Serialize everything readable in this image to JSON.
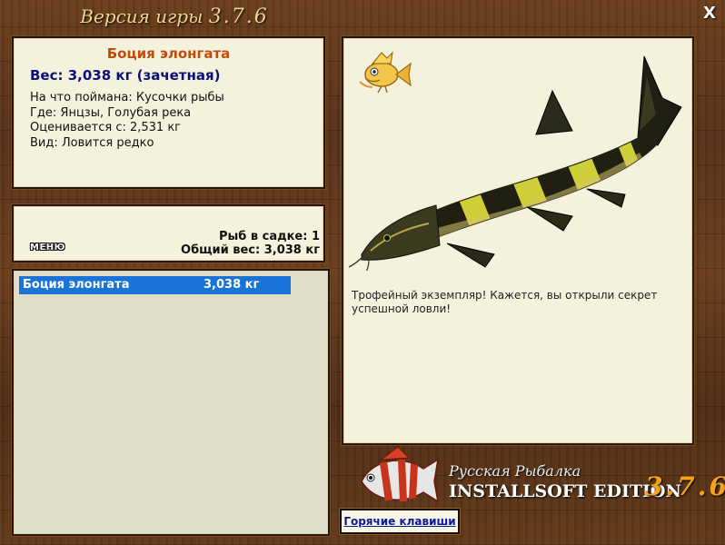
{
  "window": {
    "title_prefix": "Версия игры",
    "version": "3.7.6",
    "close_label": "X"
  },
  "fish_info": {
    "name": "Боция элонгата",
    "weight_line": "Вес: 3,038 кг (зачетная)",
    "caught_on": "На что поймана: Кусочки рыбы",
    "location": "Где: Янцзы, Голубая река",
    "rated_from": "Оценивается с: 2,531 кг",
    "species_status": "Вид: Ловится редко"
  },
  "cage": {
    "menu_label": "МЕНЮ",
    "fish_count_line": "Рыб в садке: 1",
    "total_weight_line": "Общий вес: 3,038 кг"
  },
  "catch_list": [
    {
      "name": "Боция элонгата",
      "weight": "3,038 кг",
      "selected": true
    }
  ],
  "fish_view": {
    "caption": "Трофейный экземпляр! Кажется, вы открыли секрет успешной ловли!",
    "trophy_icon": "golden-fish-trophy-icon"
  },
  "branding": {
    "line1": "Русская Рыбалка",
    "line2": "INSTALLSOFT EDITION",
    "version": "3.7.6"
  },
  "footer": {
    "hotkeys_label": "Горячие клавиши"
  },
  "colors": {
    "fish_name": "#c24a0b",
    "weight_text": "#0c0f7a",
    "selection": "#1a73d6",
    "version_orange": "#f3a21a"
  }
}
